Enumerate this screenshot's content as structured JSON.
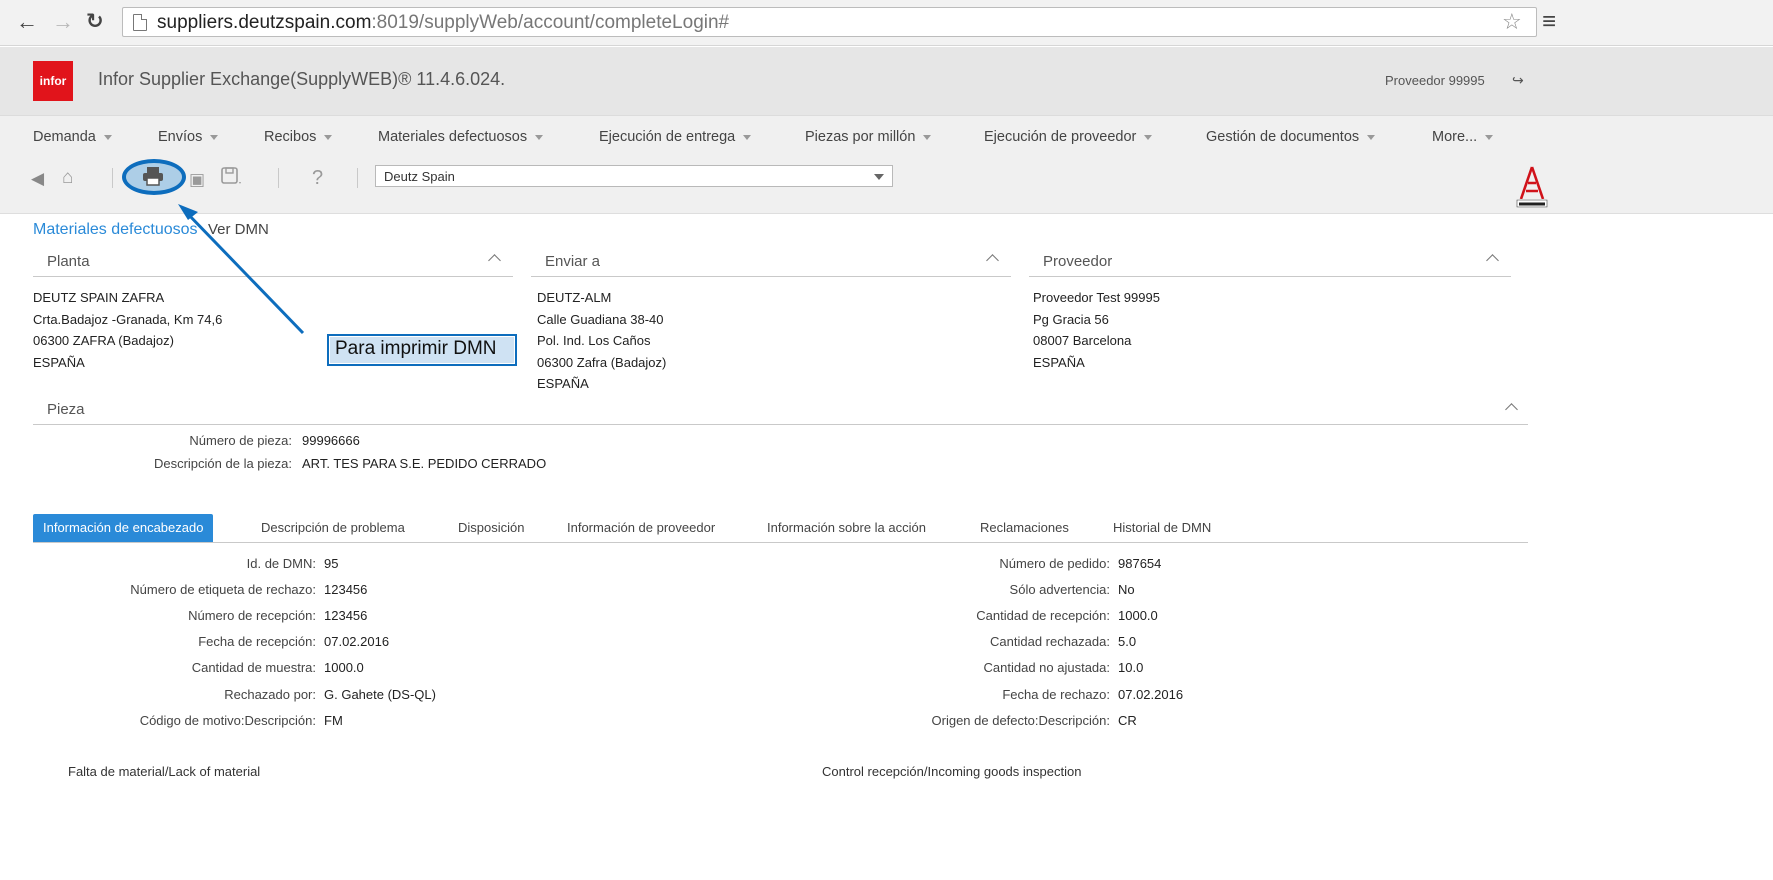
{
  "browser": {
    "url_host": "suppliers.deutzspain.com",
    "url_path": ":8019/supplyWeb/account/completeLogin#"
  },
  "header": {
    "logo_text": "infor",
    "title": "Infor Supplier Exchange(SupplyWEB)® 11.4.6.024.",
    "user": "Proveedor 99995"
  },
  "menu": [
    {
      "label": "Demanda"
    },
    {
      "label": "Envíos"
    },
    {
      "label": "Recibos"
    },
    {
      "label": "Materiales defectuosos"
    },
    {
      "label": "Ejecución de entrega"
    },
    {
      "label": "Piezas por millón"
    },
    {
      "label": "Ejecución de proveedor"
    },
    {
      "label": "Gestión de documentos"
    },
    {
      "label": "More..."
    }
  ],
  "toolbar": {
    "company_select": "Deutz Spain",
    "help": "?"
  },
  "breadcrumb": {
    "section": "Materiales defectuosos",
    "current": "Ver DMN"
  },
  "panels": {
    "planta": {
      "title": "Planta",
      "lines": [
        "DEUTZ SPAIN ZAFRA",
        "Crta.Badajoz -Granada, Km 74,6",
        "06300 ZAFRA (Badajoz)",
        "ESPAÑA"
      ]
    },
    "enviar": {
      "title": "Enviar a",
      "lines": [
        "DEUTZ-ALM",
        "Calle Guadiana 38-40",
        "Pol. Ind. Los Caños",
        "06300 Zafra (Badajoz)",
        "ESPAÑA"
      ]
    },
    "proveedor": {
      "title": "Proveedor",
      "lines": [
        "Proveedor Test 99995",
        "Pg Gracia 56",
        "08007 Barcelona",
        "ESPAÑA"
      ]
    }
  },
  "pieza": {
    "title": "Pieza",
    "part_number_label": "Número de pieza:",
    "part_number": "99996666",
    "description_label": "Descripción de la pieza:",
    "description": "ART. TES PARA S.E. PEDIDO CERRADO"
  },
  "tabs": [
    {
      "label": "Información de encabezado"
    },
    {
      "label": "Descripción de problema"
    },
    {
      "label": "Disposición"
    },
    {
      "label": "Información de proveedor"
    },
    {
      "label": "Información sobre la acción"
    },
    {
      "label": "Reclamaciones"
    },
    {
      "label": "Historial de DMN"
    }
  ],
  "header_info": {
    "left": [
      {
        "label": "Id. de DMN:",
        "value": "95"
      },
      {
        "label": "Número de etiqueta de rechazo:",
        "value": "123456"
      },
      {
        "label": "Número de recepción:",
        "value": "123456"
      },
      {
        "label": "Fecha de recepción:",
        "value": "07.02.2016"
      },
      {
        "label": "Cantidad de muestra:",
        "value": "1000.0"
      },
      {
        "label": "Rechazado por:",
        "value": "G. Gahete (DS-QL)"
      },
      {
        "label": "Código de motivo:Descripción:",
        "value": "FM"
      }
    ],
    "right": [
      {
        "label": "Número de pedido:",
        "value": "987654"
      },
      {
        "label": "Sólo advertencia:",
        "value": "No"
      },
      {
        "label": "Cantidad de recepción:",
        "value": "1000.0"
      },
      {
        "label": "Cantidad rechazada:",
        "value": "5.0"
      },
      {
        "label": "Cantidad no ajustada:",
        "value": "10.0"
      },
      {
        "label": "Fecha de rechazo:",
        "value": "07.02.2016"
      },
      {
        "label": "Origen de defecto:Descripción:",
        "value": "CR"
      }
    ],
    "left_note": "Falta de material/Lack of material",
    "right_note": "Control recepción/Incoming goods inspection"
  },
  "annotation": {
    "callout": "Para imprimir DMN",
    "color": "#0d6dbd"
  }
}
